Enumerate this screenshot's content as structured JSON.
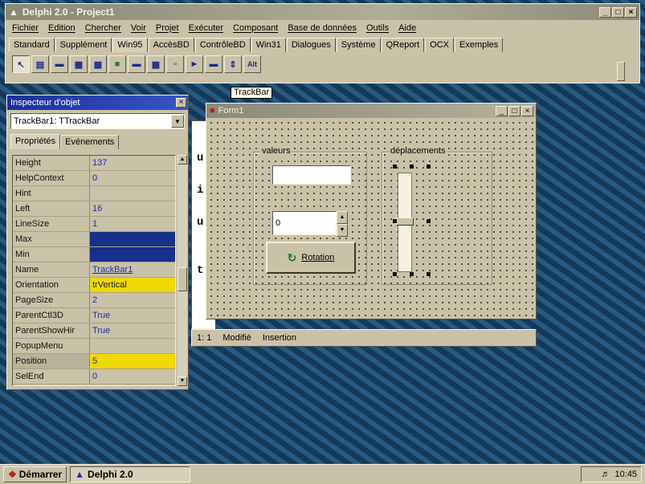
{
  "ide": {
    "title": "Delphi 2.0 - Project1",
    "menu": [
      "Fichier",
      "Edition",
      "Chercher",
      "Voir",
      "Projet",
      "Exécuter",
      "Composant",
      "Base de données",
      "Outils",
      "Aide"
    ],
    "tabs": [
      "Standard",
      "Supplément",
      "Win95",
      "AccèsBD",
      "ContrôleBD",
      "Win31",
      "Dialogues",
      "Système",
      "QReport",
      "OCX",
      "Exemples"
    ],
    "active_tab": "Win95",
    "toolbar_icons": [
      "pointer-icon",
      "tabcontrol-icon",
      "pagecontrol-icon",
      "treeview-icon",
      "listview-icon",
      "imagelist-icon",
      "header-icon",
      "richedit-icon",
      "statusbar-icon",
      "trackbar-icon",
      "progressbar-icon",
      "updown-icon",
      "hotkey-icon"
    ],
    "hotkey_label": "Alt",
    "tooltip": "TrackBar"
  },
  "inspector": {
    "title": "Inspecteur d'objet",
    "component": "TrackBar1: TTrackBar",
    "tabs": [
      "Propriétés",
      "Evénements"
    ],
    "properties": [
      {
        "name": "Height",
        "value": "137"
      },
      {
        "name": "HelpContext",
        "value": "0"
      },
      {
        "name": "Hint",
        "value": ""
      },
      {
        "name": "Left",
        "value": "16"
      },
      {
        "name": "LineSize",
        "value": "1"
      },
      {
        "name": "Max",
        "value": ""
      },
      {
        "name": "Min",
        "value": ""
      },
      {
        "name": "Name",
        "value": "TrackBar1"
      },
      {
        "name": "Orientation",
        "value": "trVertical"
      },
      {
        "name": "PageSize",
        "value": "2"
      },
      {
        "name": "ParentCtl3D",
        "value": "True"
      },
      {
        "name": "ParentShowHir",
        "value": "True"
      },
      {
        "name": "PopupMenu",
        "value": ""
      },
      {
        "name": "Position",
        "value": "5"
      },
      {
        "name": "SelEnd",
        "value": "0"
      }
    ],
    "selected_property": "Position",
    "colors": {
      "maxmin_swatch": "#16308c",
      "highlight": "#f0d800"
    }
  },
  "editor": {
    "letters": [
      "u",
      "i",
      "u",
      "t"
    ],
    "status": {
      "position": "1: 1",
      "state": "Modifié",
      "mode": "Insertion"
    }
  },
  "form": {
    "title": "Form1",
    "group_valeurs": "valeurs",
    "group_deplacements": "déplacements",
    "edit_value": "",
    "spin_value": "0",
    "button_label": "Rotation"
  },
  "taskbar": {
    "start_label": "Démarrer",
    "task_label": "Delphi 2.0",
    "clock": "10:45"
  }
}
